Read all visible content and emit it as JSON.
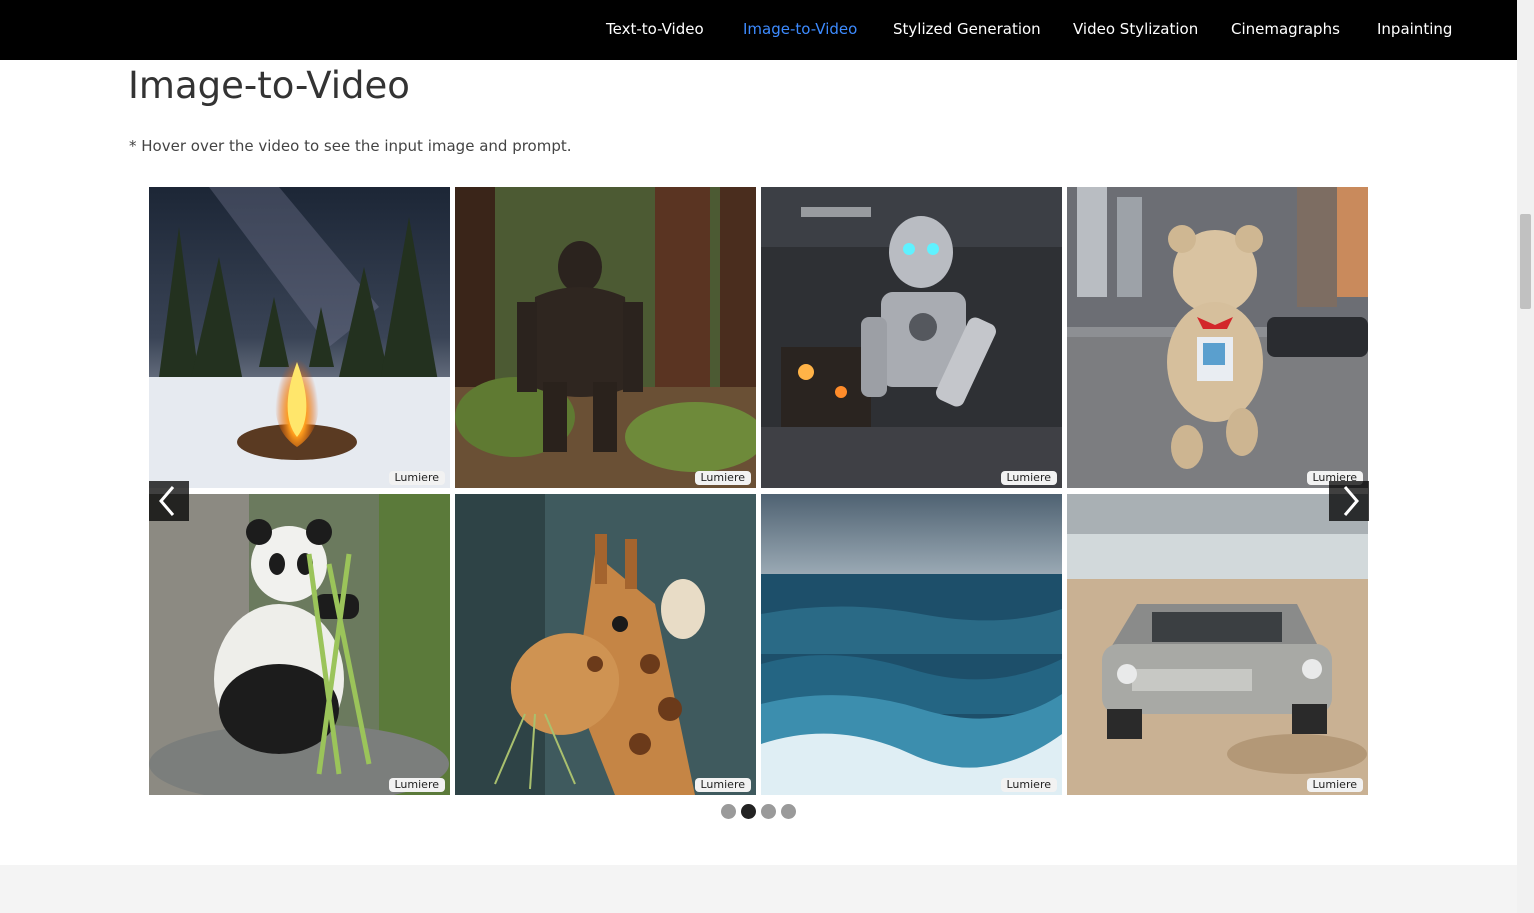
{
  "nav": {
    "items": [
      {
        "label": "Text-to-Video",
        "active": false
      },
      {
        "label": "Image-to-Video",
        "active": true
      },
      {
        "label": "Stylized Generation",
        "active": false
      },
      {
        "label": "Video Stylization",
        "active": false
      },
      {
        "label": "Cinemagraphs",
        "active": false
      },
      {
        "label": "Inpainting",
        "active": false
      }
    ],
    "active_color": "#3d8bff"
  },
  "section": {
    "title": "Image-to-Video",
    "note": "* Hover over the video to see the input image and prompt."
  },
  "gallery": {
    "badge_label": "Lumiere",
    "tiles": [
      {
        "subject": "campfire in snowy forest under milky way"
      },
      {
        "subject": "bigfoot walking in redwood forest"
      },
      {
        "subject": "robot working at a workbench"
      },
      {
        "subject": "teddy bear walking on city street"
      },
      {
        "subject": "panda eating bamboo"
      },
      {
        "subject": "giraffe eating grass"
      },
      {
        "subject": "ocean waves"
      },
      {
        "subject": "vintage car on beach"
      }
    ],
    "prev_icon": "chevron-left-icon",
    "next_icon": "chevron-right-icon",
    "pages": 4,
    "current_page": 2
  }
}
